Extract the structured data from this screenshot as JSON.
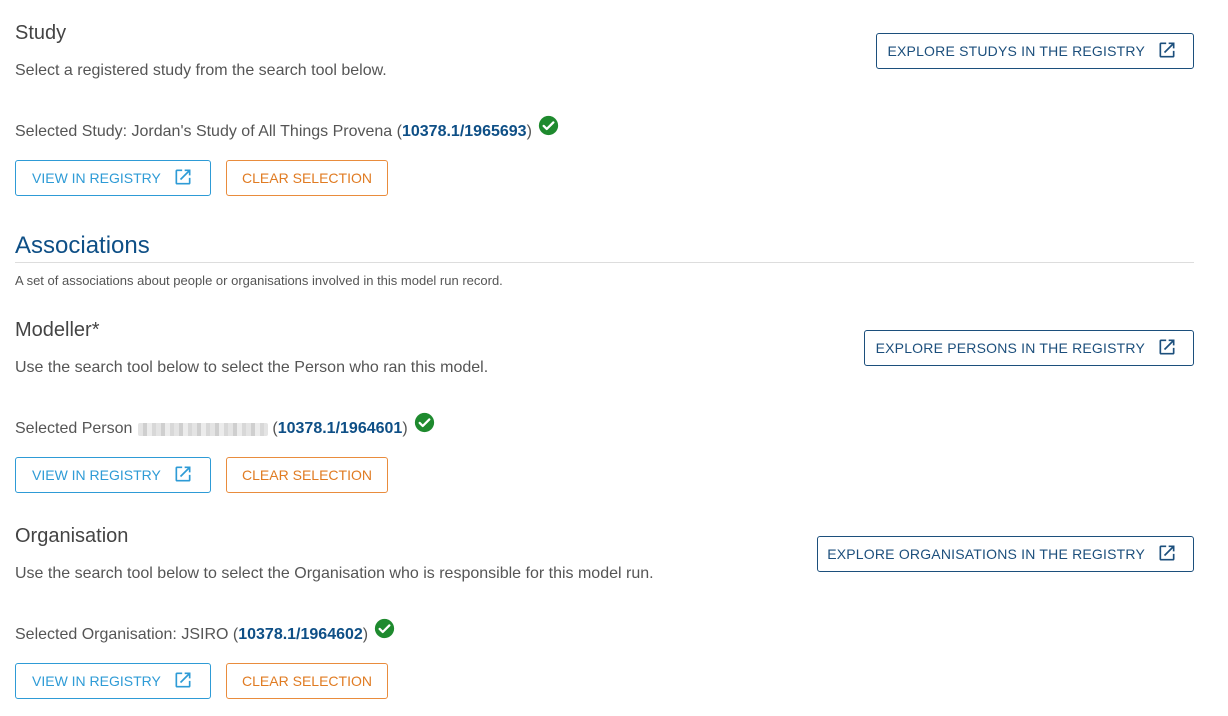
{
  "study": {
    "title": "Study",
    "description": "Select a registered study from the search tool below.",
    "explore_label": "EXPLORE STUDYS IN THE REGISTRY",
    "selected_prefix": "Selected Study: Jordan's Study of All Things Provena (",
    "handle": "10378.1/1965693",
    "selected_suffix": ")",
    "view_label": "VIEW IN REGISTRY",
    "clear_label": "CLEAR SELECTION"
  },
  "associations": {
    "title": "Associations",
    "description": "A set of associations about people or organisations involved in this model run record."
  },
  "modeller": {
    "title": "Modeller*",
    "description": "Use the search tool below to select the Person who ran this model.",
    "explore_label": "EXPLORE PERSONS IN THE REGISTRY",
    "selected_prefix": "Selected Person",
    "selected_open": "(",
    "handle": "10378.1/1964601",
    "selected_suffix": ")",
    "view_label": "VIEW IN REGISTRY",
    "clear_label": "CLEAR SELECTION"
  },
  "organisation": {
    "title": "Organisation",
    "description": "Use the search tool below to select the Organisation who is responsible for this model run.",
    "explore_label": "EXPLORE ORGANISATIONS IN THE REGISTRY",
    "selected_prefix": "Selected Organisation: JSIRO (",
    "handle": "10378.1/1964602",
    "selected_suffix": ")",
    "view_label": "VIEW IN REGISTRY",
    "clear_label": "CLEAR SELECTION"
  },
  "colors": {
    "primary": "#1c4f7c",
    "link": "#0e4f86",
    "view_button": "#2e9bd6",
    "clear_button": "#e07b22",
    "success": "#1e8a2e"
  },
  "icons": {
    "external": "external-link-icon",
    "check": "check-circle-icon"
  }
}
